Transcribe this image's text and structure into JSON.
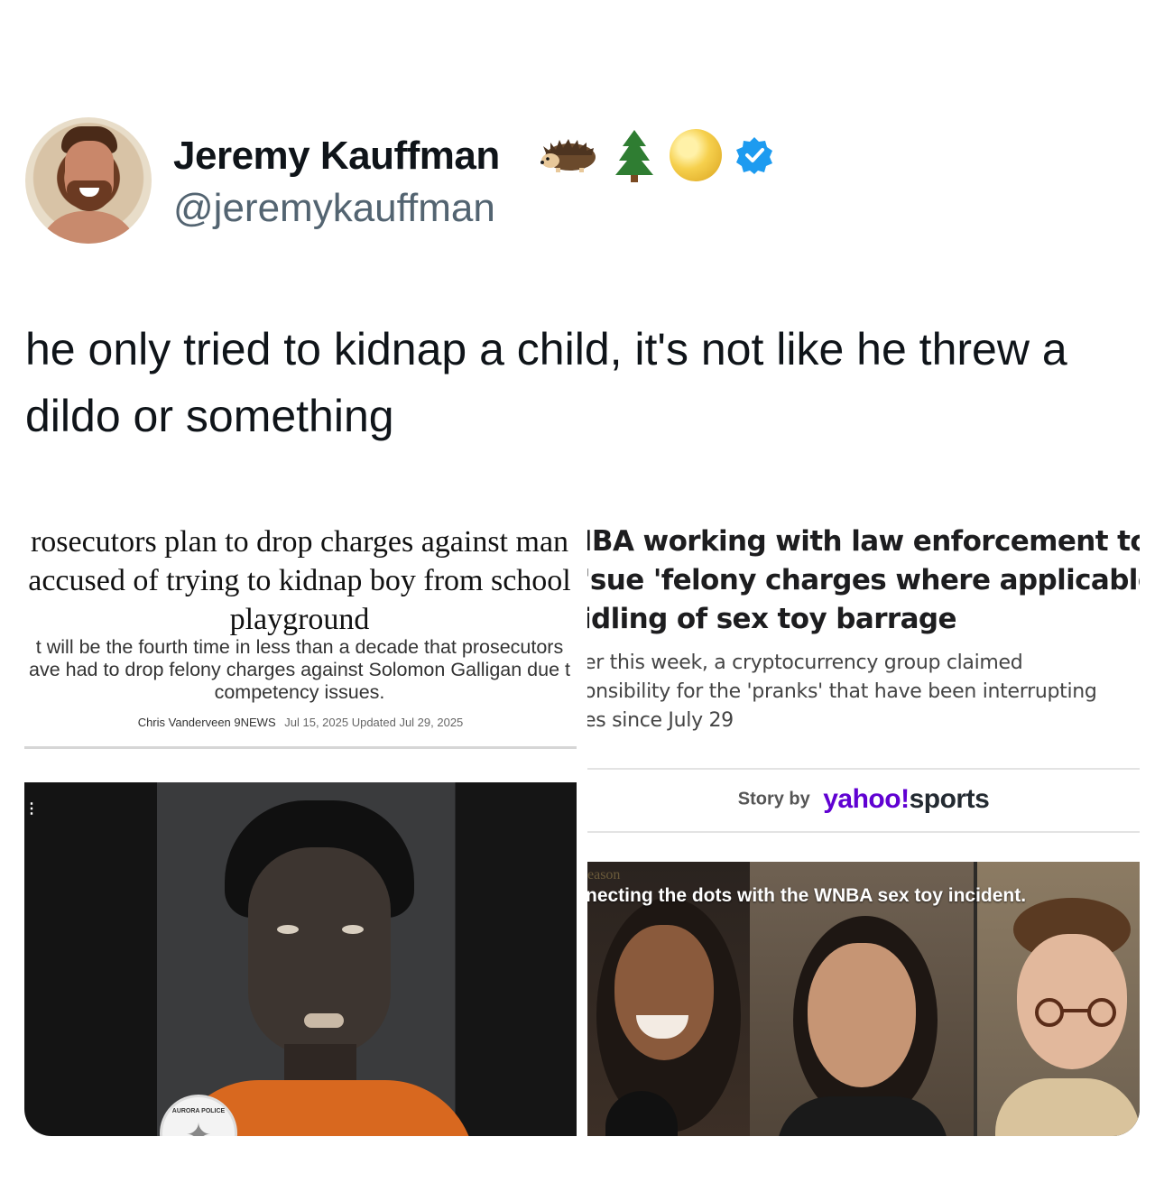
{
  "user": {
    "name": "Jeremy Kauffman",
    "handle": "@jeremykauffman",
    "name_emojis": [
      "hedgehog-icon",
      "evergreen-tree-icon",
      "full-moon-icon"
    ],
    "verified": true,
    "verified_color": "#1d9bf0"
  },
  "tweet": {
    "text": "he only tried to kidnap a child, it's not like he threw a dildo or something"
  },
  "media_left": {
    "headline_lines": [
      "rosecutors plan to drop charges against man",
      "accused of trying to kidnap boy from school",
      "playground"
    ],
    "subhead_lines": [
      "t will be the fourth time in less than a decade that prosecutors",
      "ave had to drop felony charges against Solomon Galligan due t",
      "competency issues."
    ],
    "byline": "Chris Vanderveen 9NEWS",
    "date": "Jul 15, 2025 Updated Jul 29, 2025",
    "badge_text": "AURORA POLICE"
  },
  "media_right": {
    "headline_lines": [
      "IBA working with law enforcement to",
      "'sue 'felony charges where applicable' i",
      "idling of sex toy barrage"
    ],
    "subhead_lines": [
      "er this week, a cryptocurrency group claimed",
      "onsibility for the 'pranks' that have been interrupting",
      "es since July 29"
    ],
    "story_by_label": "Story by",
    "brand_yahoo": "yahoo!",
    "brand_sports": "sports",
    "brand_color": "#6001d2",
    "video_overlay_small": "eason",
    "video_caption": "necting the dots with the WNBA sex toy incident."
  }
}
